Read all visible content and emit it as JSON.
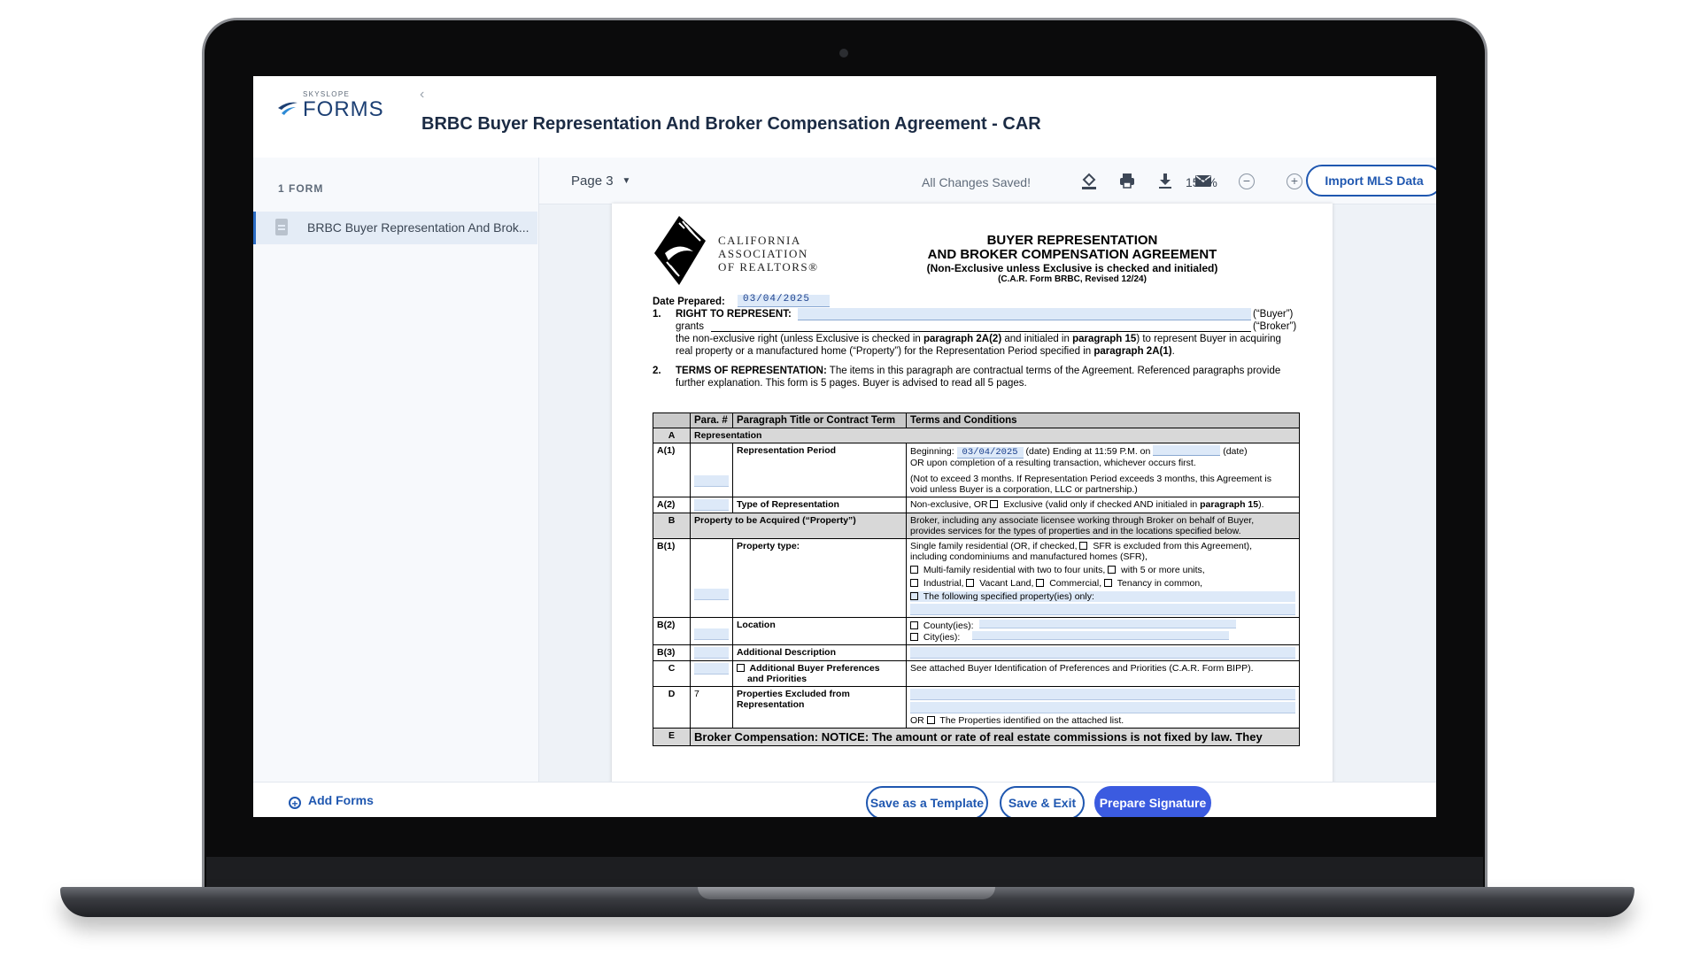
{
  "app": {
    "logo_top": "SKYSLOPE",
    "logo_main": "FORMS",
    "back_icon": "chevron-left-icon",
    "title": "BRBC Buyer Representation And Broker Compensation Agreement - CAR"
  },
  "sidebar": {
    "heading": "1 FORM",
    "items": [
      {
        "label": "BRBC Buyer Representation And Brok...",
        "icon": "document-icon",
        "selected": true
      }
    ]
  },
  "toolbar": {
    "page_label": "Page 3",
    "status": "All Changes Saved!",
    "icons": [
      "fill-icon",
      "print-icon",
      "download-icon",
      "email-icon"
    ],
    "zoom": "150%",
    "import_button": "Import MLS Data"
  },
  "footer": {
    "add_forms": "Add Forms",
    "save_template": "Save as a Template",
    "save_exit": "Save & Exit",
    "prepare_signature": "Prepare Signature"
  },
  "form": {
    "org_line1": "CALIFORNIA",
    "org_line2": "ASSOCIATION",
    "org_line3": "OF REALTORS®",
    "title1": "BUYER REPRESENTATION",
    "title2": "AND BROKER COMPENSATION AGREEMENT",
    "title3": "(Non-Exclusive unless Exclusive is checked and initialed)",
    "title4": "(C.A.R. Form BRBC, Revised 12/24)",
    "date_label": "Date Prepared:",
    "date_value": "03/04/2025",
    "s1_num": "1.",
    "s1_label": "RIGHT TO REPRESENT:",
    "buyer_tag": "(“Buyer”)",
    "grants": "grants",
    "broker_tag": "(“Broker”)",
    "s1_line3_a": "the non-exclusive right (unless Exclusive is checked in ",
    "s1_line3_b": "paragraph 2A(2)",
    "s1_line3_c": " and initialed in ",
    "s1_line3_d": "paragraph 15",
    "s1_line3_e": ") to represent Buyer in acquiring",
    "s1_line4_a": "real property or a manufactured home (“Property”) for the Representation Period specified in ",
    "s1_line4_b": "paragraph 2A(1)",
    "s1_line4_c": ".",
    "s2_num": "2.",
    "s2_label": "TERMS OF REPRESENTATION:",
    "s2_text1": " The items in this paragraph are contractual terms of the Agreement. Referenced paragraphs provide",
    "s2_text2": "further explanation.  This form is 5 pages.  Buyer is advised to read all 5 pages.",
    "table": {
      "headers": [
        "",
        "Para. #",
        "Paragraph Title or Contract Term",
        "Terms and Conditions"
      ],
      "sec_a": {
        "key": "A",
        "title": "Representation"
      },
      "a1": {
        "key": "A(1)",
        "title": "Representation Period",
        "begin_label": "Beginning:",
        "begin_value": "03/04/2025",
        "ending": "(date) Ending at 11:59 P.M. on",
        "date_tag": "(date)",
        "line2": "OR upon completion of a resulting transaction, whichever occurs first.",
        "note1": "(Not to exceed 3 months.  If Representation Period exceeds 3 months, this Agreement is",
        "note2": "void unless Buyer is a corporation, LLC or partnership.)"
      },
      "a2": {
        "key": "A(2)",
        "title": "Type of Representation",
        "text_a": "Non-exclusive, OR ",
        "text_b": " Exclusive (valid only if checked AND initialed in ",
        "text_c": "paragraph 15",
        "text_d": ")."
      },
      "b": {
        "key": "B",
        "title": "Property to be Acquired (“Property”)",
        "line1": "Broker, including any associate licensee working through Broker on behalf of Buyer,",
        "line2": "provides services for the types of properties and in the locations specified below."
      },
      "b1": {
        "key": "B(1)",
        "title": "Property type:",
        "line1a": "Single family residential (OR, if checked, ",
        "line1b": " SFR is excluded from this Agreement),",
        "line2": "including condominiums and manufactured homes (SFR),",
        "line3a": " Multi-family residential with two to four units, ",
        "line3b": " with 5 or more units,",
        "line4a": " Industrial, ",
        "line4b": " Vacant Land, ",
        "line4c": " Commercial, ",
        "line4d": " Tenancy in common,",
        "line5": " The following specified property(ies) only:"
      },
      "b2": {
        "key": "B(2)",
        "title": "Location",
        "county": " County(ies):",
        "city": " City(ies):"
      },
      "b3": {
        "key": "B(3)",
        "title": "Additional Description"
      },
      "c": {
        "key": "C",
        "title_a": " Additional Buyer Preferences",
        "title_b": "and Priorities",
        "text": "See attached Buyer Identification of Preferences and Priorities (C.A.R. Form BIPP)."
      },
      "d": {
        "key": "D",
        "para": "7",
        "title_a": "Properties Excluded from",
        "title_b": "Representation",
        "text": "OR ",
        "text_b": " The Properties identified on the attached list."
      },
      "e": {
        "key": "E",
        "text": "Broker Compensation: NOTICE: The amount or rate of real estate commissions is not fixed by law. They"
      }
    }
  }
}
